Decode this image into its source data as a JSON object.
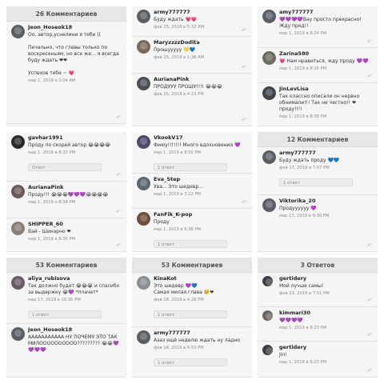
{
  "p1": {
    "header": "26 Комментариев",
    "comments": [
      {
        "user": "Jeon_Hoseok18",
        "text": "Оо, автор,уснелини я тебе ((\n\nПечально, что главы только по воскресеньям, но все же... я всегда буду ждать ❤❤\n\nУспехов тебе ~ 💗",
        "meta": "мар 1, 2019 в 2:04 AM"
      }
    ]
  },
  "p2": {
    "comments": [
      {
        "user": "army777777",
        "text": "Буду ждать 💗💗",
        "meta": "фев 25, 2019 в 5:32 AM"
      },
      {
        "user": "MaryzzzzDodita",
        "text": "Прошууууу 💛💙",
        "meta": "фев 25, 2019 в 1:36 AM"
      },
      {
        "user": "AurianaPink",
        "text": "ПРОДУУУ ПРОШУ!!!! 😭😭😭",
        "meta": "фев 25, 2019 в 4:23 PM"
      }
    ]
  },
  "p3": {
    "comments": [
      {
        "user": "amy777777",
        "text": "💜💜💜💜Вау просто прекрасно! Жду прод!!",
        "meta": "мар 1, 2019 в 8:24 PM"
      },
      {
        "user": "Zarina580",
        "text": "💗 Нам нравиться, жду проду 💜💜",
        "meta": "мар 1, 2019 в 8:26 PM"
      },
      {
        "user": "JinLevLisa",
        "text": "Так классно описали он нервно обнимали!!! Так не честно!! ❤ проду!!!!",
        "meta": "мар 1, 2019 в 8:38 PM"
      }
    ]
  },
  "p4": {
    "comments": [
      {
        "user": "gavhar1991",
        "text": "Проду по скорей автор 😭😭😭😭",
        "meta": "мар 1, 2019 в 8:33 PM",
        "reply": "Ответ"
      },
      {
        "user": "AurianaPink",
        "text": "Проду!!! 😭😭😭💜💜💜😭😭😭😭",
        "meta": "мар 1, 2019 в 8:34 PM"
      },
      {
        "user": "SHIPPER_60",
        "text": "Вай - Шикарно ❤",
        "meta": "мар 1, 2019 в 8:36 PM"
      }
    ]
  },
  "p5": {
    "comments": [
      {
        "user": "VkookV17",
        "text": "Фиюу!!!!!!! Много вдохновения 💜",
        "meta": "мар 1, 2019 в 8:50 PM",
        "reply": "1 ответ"
      },
      {
        "user": "Eva_Step",
        "text": "Ува... Это шедевр...",
        "meta": "мар 1, 2019 в 3:12 PM"
      },
      {
        "user": "FanFik_K-pop",
        "text": "Проду",
        "meta": "мар 1, 2019 в 6:36 PM",
        "reply": "1 ответ"
      }
    ]
  },
  "p6": {
    "header": "12 Комментариев",
    "comments": [
      {
        "user": "army777777",
        "text": "Буду ждать проду 💙💙",
        "meta": "фев 17, 2019 в 7:57 PM",
        "reply": "1 ответ"
      },
      {
        "user": "Viktorika_20",
        "text": "Продуууууу 💜",
        "meta": "мар 17, 2019 в 9:30 PM"
      }
    ]
  },
  "p7": {
    "header": "53 Комментариев",
    "comments": [
      {
        "user": "aliya_rubisova",
        "text": "Так должно будет 😭😭😭 и спасибо за выдержку 😭💜 *плачет*",
        "meta": "мар 17, 2019 в 10:35 PM",
        "reply": "1 ответ"
      },
      {
        "user": "Jeon_Hoseok18",
        "text": "ААААААААААА НУ ПОЧЕМУ ЭТО ТАК МИЛОООООООООО????????? 😭😭💜💜💜💜",
        "meta": ""
      }
    ]
  },
  "p8": {
    "header": "53 Комментариев",
    "comments": [
      {
        "user": "KinaKot",
        "text": "Это шедевр 💜💙\nСамая милая глава 🥺❤",
        "meta": "фев 18, 2019 в 4:28 PM",
        "reply": "1 ответ"
      },
      {
        "user": "army777777",
        "text": "Азаз ещё неделю ждать ну ладно",
        "meta": "фев 18, 2019 в 6:53 PM",
        "reply": "1 ответ"
      }
    ]
  },
  "p9": {
    "header": "3 Ответов",
    "comments": [
      {
        "user": "gertidery",
        "text": "Мой лучше самы!",
        "meta": "фев 23, 2019 в 7:51 PM"
      },
      {
        "user": "kimmari30",
        "text": "💜💜💜💜",
        "meta": "мар 1, 2019 в 8:23 PM"
      },
      {
        "user": "gertidery",
        "text": "Jin!",
        "meta": "мар 1, 2019 в 9:23 PM"
      }
    ]
  },
  "icons": {
    "reply_arrow": "↶"
  }
}
